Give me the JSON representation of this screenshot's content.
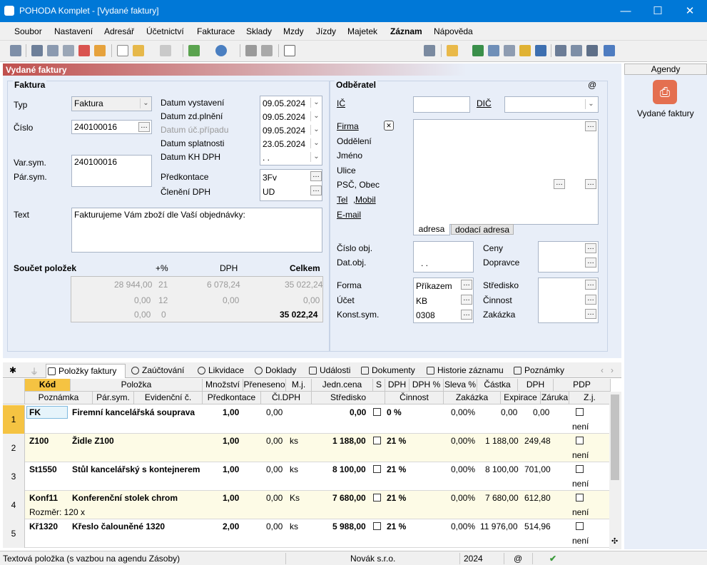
{
  "window": {
    "title": "POHODA Komplet - [Vydané faktury]",
    "minimize": "—",
    "maximize": "☐",
    "close": "✕"
  },
  "menu": [
    "Soubor",
    "Nastavení",
    "Adresář",
    "Účetnictví",
    "Fakturace",
    "Sklady",
    "Mzdy",
    "Jízdy",
    "Majetek",
    "Záznam",
    "Nápověda"
  ],
  "panel_title": "Vydané faktury",
  "agendy": {
    "header": "Agendy",
    "item": "Vydané faktury"
  },
  "faktura": {
    "section": "Faktura",
    "typ_label": "Typ",
    "typ_value": "Faktura",
    "cislo_label": "Číslo",
    "cislo_value": "240100016",
    "varsym_label": "Var.sym.",
    "varsym_value": "240100016",
    "parsym_label": "Pár.sym.",
    "text_label": "Text",
    "text_value": "Fakturujeme Vám zboží dle Vaší objednávky:",
    "datum_vystaveni_label": "Datum vystavení",
    "datum_vystaveni": "09.05.2024",
    "datum_zdpl_label": "Datum zd.plnění",
    "datum_zdpl": "09.05.2024",
    "datum_ucp_label": "Datum úč.případu",
    "datum_ucp": "09.05.2024",
    "datum_splatnosti_label": "Datum splatnosti",
    "datum_splatnosti": "23.05.2024",
    "datum_kh_label": "Datum KH DPH",
    "datum_kh": " .  .",
    "predkontace_label": "Předkontace",
    "predkontace": "3Fv",
    "cleneni_label": "Členění DPH",
    "cleneni": "UD"
  },
  "soucet": {
    "label": "Součet položek",
    "h_pct": "+%",
    "h_dph": "DPH",
    "h_celkem": "Celkem",
    "rows": [
      {
        "zaklad": "28 944,00",
        "pct": "21",
        "dph": "6 078,24",
        "celkem": "35 022,24"
      },
      {
        "zaklad": "0,00",
        "pct": "12",
        "dph": "0,00",
        "celkem": "0,00"
      },
      {
        "zaklad": "0,00",
        "pct": "0",
        "dph": "",
        "celkem": "35 022,24"
      }
    ]
  },
  "odberatel": {
    "section": "Odběratel",
    "at": "@",
    "ic": "IČ",
    "dic": "DIČ",
    "firma": "Firma",
    "oddeleni": "Oddělení",
    "jmeno": "Jméno",
    "ulice": "Ulice",
    "psc": "PSČ, Obec",
    "tel": "Tel",
    "mobil": "Mobil",
    "email": "E-mail",
    "tab_adresa": "adresa",
    "tab_dodaci": "dodací adresa",
    "cislo_obj": "Číslo obj.",
    "dat_obj": "Dat.obj.",
    "dat_obj_value": " .  .",
    "ceny": "Ceny",
    "dopravce": "Dopravce",
    "forma": "Forma",
    "forma_value": "Příkazem",
    "ucet": "Účet",
    "ucet_value": "KB",
    "konst": "Konst.sym.",
    "konst_value": "0308",
    "stredisko": "Středisko",
    "cinnost": "Činnost",
    "zakazka": "Zakázka"
  },
  "tabs": [
    "Položky faktury",
    "Zaúčtování",
    "Likvidace",
    "Doklady",
    "Události",
    "Dokumenty",
    "Historie záznamu",
    "Poznámky"
  ],
  "grid_header1": [
    "Kód",
    "Položka",
    "Množství",
    "Přeneseno",
    "M.j.",
    "Jedn.cena",
    "S",
    "DPH",
    "DPH %",
    "Sleva %",
    "Částka",
    "DPH",
    "PDP"
  ],
  "grid_header2": [
    "Poznámka",
    "Pár.sym.",
    "Evidenční č.",
    "Předkontace",
    "Čl.DPH",
    "Středisko",
    "Činnost",
    "Zakázka",
    "Expirace",
    "Záruka",
    "Z.j."
  ],
  "rows": [
    {
      "n": "1",
      "kod": "FK",
      "polozka": "Firemní kancelářská souprava",
      "mnozstvi": "1,00",
      "preneseno": "0,00",
      "mj": "",
      "cena": "0,00",
      "dph": "0 %",
      "sleva": "0,00%",
      "castka": "0,00",
      "dphc": "0,00",
      "note": "",
      "pdp": "není"
    },
    {
      "n": "2",
      "kod": "Z100",
      "polozka": "Židle Z100",
      "mnozstvi": "1,00",
      "preneseno": "0,00",
      "mj": "ks",
      "cena": "1 188,00",
      "dph": "21 %",
      "sleva": "0,00%",
      "castka": "1 188,00",
      "dphc": "249,48",
      "note": "",
      "pdp": "není"
    },
    {
      "n": "3",
      "kod": "St1550",
      "polozka": "Stůl kancelářský s kontejnerem",
      "mnozstvi": "1,00",
      "preneseno": "0,00",
      "mj": "ks",
      "cena": "8 100,00",
      "dph": "21 %",
      "sleva": "0,00%",
      "castka": "8 100,00",
      "dphc": "701,00",
      "note": "",
      "pdp": "není"
    },
    {
      "n": "4",
      "kod": "Konf11",
      "polozka": "Konferenční stolek chrom",
      "mnozstvi": "1,00",
      "preneseno": "0,00",
      "mj": "Ks",
      "cena": "7 680,00",
      "dph": "21 %",
      "sleva": "0,00%",
      "castka": "7 680,00",
      "dphc": "612,80",
      "note": "Rozměr: 120 x",
      "pdp": "není"
    },
    {
      "n": "5",
      "kod": "Kř1320",
      "polozka": "Křeslo čalouněné 1320",
      "mnozstvi": "2,00",
      "preneseno": "0,00",
      "mj": "ks",
      "cena": "5 988,00",
      "dph": "21 %",
      "sleva": "0,00%",
      "castka": "11 976,00",
      "dphc": "514,96",
      "note": "",
      "pdp": "není"
    }
  ],
  "status": {
    "text": "Textová položka (s vazbou na agendu Zásoby)",
    "company": "Novák s.r.o.",
    "year": "2024",
    "at": "@",
    "check": "✔"
  },
  "colors": {
    "titlebar": "#0078d7",
    "panel_title_from": "#c0504d",
    "panel_bg": "#e8eef8",
    "row_yellow": "#fdfbe6",
    "row_selected": "#f5c342"
  }
}
